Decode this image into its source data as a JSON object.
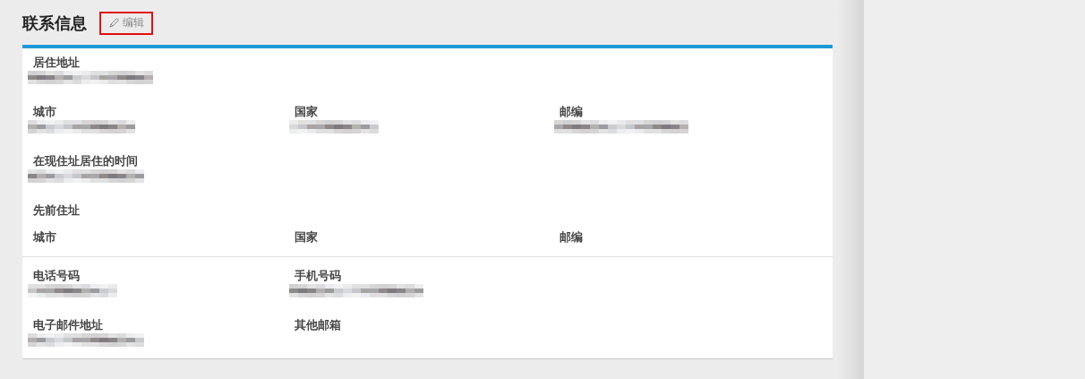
{
  "header": {
    "title": "联系信息",
    "edit_button": {
      "label": "编辑",
      "highlighted": true
    }
  },
  "sections": [
    {
      "rows": [
        {
          "fields": [
            {
              "label": "居住地址",
              "redacted": true
            }
          ]
        },
        {
          "fields": [
            {
              "label": "城市",
              "redacted": true
            },
            {
              "label": "国家",
              "redacted": true
            },
            {
              "label": "邮编",
              "redacted": true
            }
          ]
        },
        {
          "fields": [
            {
              "label": "在现住址居住的时间",
              "redacted": true
            }
          ]
        },
        {
          "fields": [
            {
              "label": "先前住址",
              "redacted": false
            }
          ]
        },
        {
          "fields": [
            {
              "label": "城市",
              "redacted": false
            },
            {
              "label": "国家",
              "redacted": false
            },
            {
              "label": "邮编",
              "redacted": false
            }
          ]
        }
      ]
    },
    {
      "rows": [
        {
          "fields": [
            {
              "label": "电话号码",
              "redacted": true
            },
            {
              "label": "手机号码",
              "redacted": true
            }
          ]
        },
        {
          "fields": [
            {
              "label": "电子邮件地址",
              "redacted": true
            },
            {
              "label": "其他邮箱",
              "redacted": false
            }
          ]
        }
      ]
    }
  ]
}
